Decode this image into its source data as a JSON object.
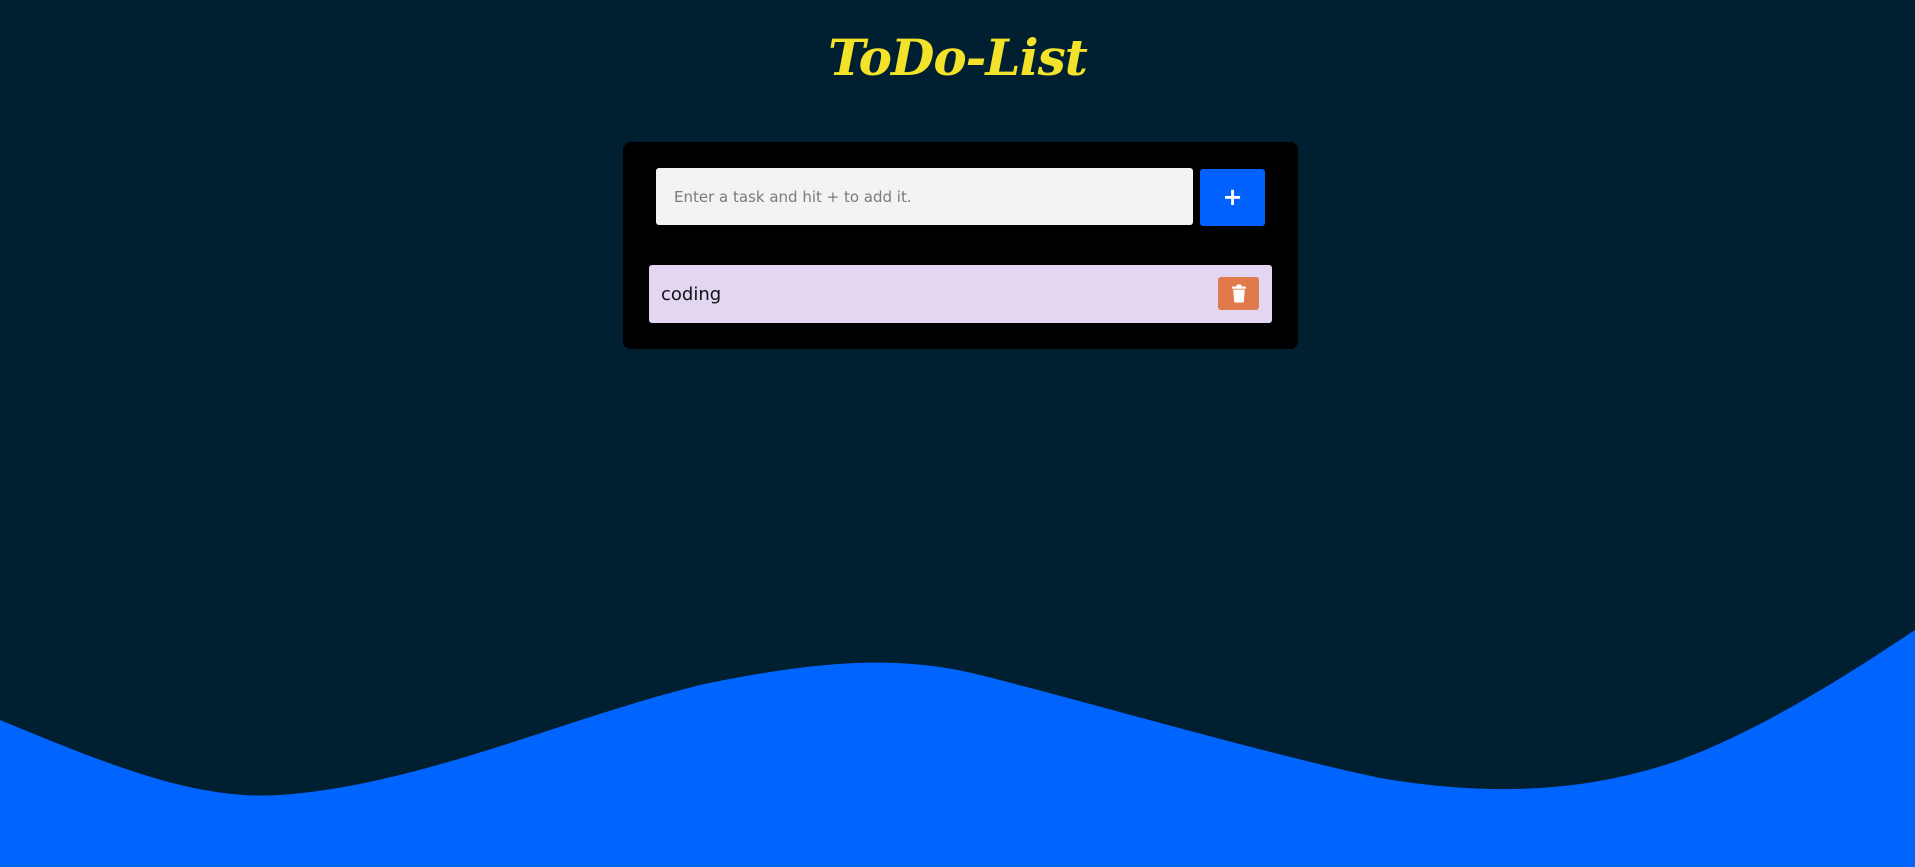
{
  "app": {
    "title": "ToDo-List"
  },
  "form": {
    "input_value": "",
    "input_placeholder": "Enter a task and hit + to add it.",
    "add_button_label": "+"
  },
  "tasks": [
    {
      "text": "coding",
      "delete_icon": "trash-icon"
    }
  ],
  "colors": {
    "background": "#001f31",
    "wave": "#0065ff",
    "title": "#f2e32a",
    "card": "#000000",
    "input_bg": "#f3f3f3",
    "add_button": "#0061fe",
    "task_bg": "#e2d6f2",
    "delete_button": "#e07a4a"
  }
}
